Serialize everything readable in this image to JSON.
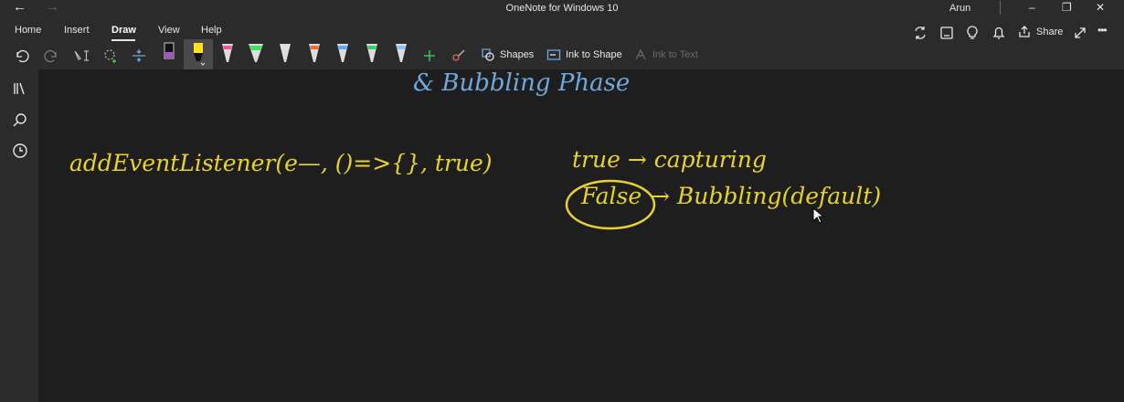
{
  "titlebar": {
    "title": "OneNote for Windows 10",
    "user": "Arun",
    "controls": [
      "–",
      "❐",
      "✕"
    ],
    "nav": {
      "back": "←",
      "forward": "→"
    }
  },
  "ribbon": {
    "tabs": [
      {
        "label": "Home"
      },
      {
        "label": "Insert"
      },
      {
        "label": "Draw",
        "active": true
      },
      {
        "label": "View"
      },
      {
        "label": "Help"
      }
    ],
    "share_label": "Share",
    "more_label": "•••",
    "buttons": {
      "shapes": "Shapes",
      "ink_to_shape": "Ink to Shape",
      "ink_to_text": "Ink to Text"
    },
    "pen_colors": [
      "#b14cd6",
      "#ffe11c",
      "#ff4fa0",
      "#39e65a",
      "#e0e0e0",
      "#ff6a2e",
      "#5aa7ff",
      "#2fd06b",
      "#86c2ff"
    ]
  },
  "canvas": {
    "ink_colors": {
      "blue": "#6fa8dc",
      "yellow": "#e8d32e"
    },
    "notes": {
      "heading": "& Bubbling Phase",
      "code": "addEventListener(e—, ()=>{}, true)",
      "line1": "true → capturing",
      "line2_word": "False",
      "line2_rest": "→ Bubbling(default)"
    }
  }
}
